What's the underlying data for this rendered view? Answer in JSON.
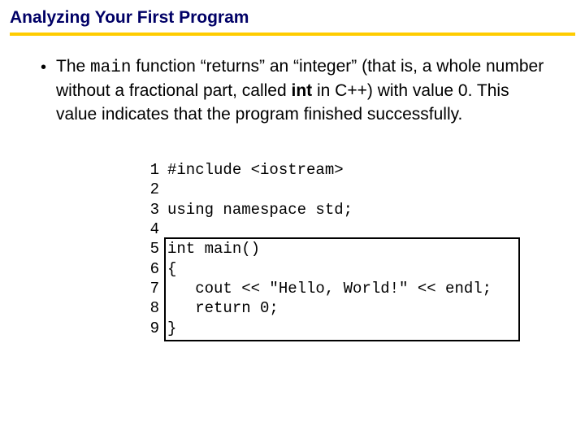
{
  "header": {
    "title": "Analyzing Your First Program"
  },
  "body": {
    "text_before_main": "The ",
    "main_word": "main",
    "text_after_main": " function “returns” an “integer” (that is, a whole number without a fractional part, called ",
    "int_word": "int",
    "text_after_int": " in C++) with value 0. This value indicates that the program finished successfully."
  },
  "code": {
    "lines": [
      {
        "n": "1",
        "t": "#include <iostream>"
      },
      {
        "n": "2",
        "t": ""
      },
      {
        "n": "3",
        "t": "using namespace std;"
      },
      {
        "n": "4",
        "t": ""
      },
      {
        "n": "5",
        "t": "int main()"
      },
      {
        "n": "6",
        "t": "{"
      },
      {
        "n": "7",
        "t": "   cout << \"Hello, World!\" << endl;"
      },
      {
        "n": "8",
        "t": "   return 0;"
      },
      {
        "n": "9",
        "t": "}"
      }
    ]
  }
}
